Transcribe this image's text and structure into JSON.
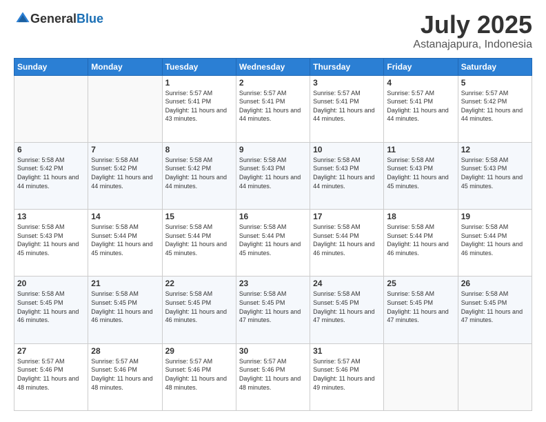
{
  "logo": {
    "text_general": "General",
    "text_blue": "Blue"
  },
  "header": {
    "month": "July 2025",
    "location": "Astanajapura, Indonesia"
  },
  "weekdays": [
    "Sunday",
    "Monday",
    "Tuesday",
    "Wednesday",
    "Thursday",
    "Friday",
    "Saturday"
  ],
  "weeks": [
    [
      {
        "day": "",
        "sunrise": "",
        "sunset": "",
        "daylight": ""
      },
      {
        "day": "",
        "sunrise": "",
        "sunset": "",
        "daylight": ""
      },
      {
        "day": "1",
        "sunrise": "Sunrise: 5:57 AM",
        "sunset": "Sunset: 5:41 PM",
        "daylight": "Daylight: 11 hours and 43 minutes."
      },
      {
        "day": "2",
        "sunrise": "Sunrise: 5:57 AM",
        "sunset": "Sunset: 5:41 PM",
        "daylight": "Daylight: 11 hours and 44 minutes."
      },
      {
        "day": "3",
        "sunrise": "Sunrise: 5:57 AM",
        "sunset": "Sunset: 5:41 PM",
        "daylight": "Daylight: 11 hours and 44 minutes."
      },
      {
        "day": "4",
        "sunrise": "Sunrise: 5:57 AM",
        "sunset": "Sunset: 5:41 PM",
        "daylight": "Daylight: 11 hours and 44 minutes."
      },
      {
        "day": "5",
        "sunrise": "Sunrise: 5:57 AM",
        "sunset": "Sunset: 5:42 PM",
        "daylight": "Daylight: 11 hours and 44 minutes."
      }
    ],
    [
      {
        "day": "6",
        "sunrise": "Sunrise: 5:58 AM",
        "sunset": "Sunset: 5:42 PM",
        "daylight": "Daylight: 11 hours and 44 minutes."
      },
      {
        "day": "7",
        "sunrise": "Sunrise: 5:58 AM",
        "sunset": "Sunset: 5:42 PM",
        "daylight": "Daylight: 11 hours and 44 minutes."
      },
      {
        "day": "8",
        "sunrise": "Sunrise: 5:58 AM",
        "sunset": "Sunset: 5:42 PM",
        "daylight": "Daylight: 11 hours and 44 minutes."
      },
      {
        "day": "9",
        "sunrise": "Sunrise: 5:58 AM",
        "sunset": "Sunset: 5:43 PM",
        "daylight": "Daylight: 11 hours and 44 minutes."
      },
      {
        "day": "10",
        "sunrise": "Sunrise: 5:58 AM",
        "sunset": "Sunset: 5:43 PM",
        "daylight": "Daylight: 11 hours and 44 minutes."
      },
      {
        "day": "11",
        "sunrise": "Sunrise: 5:58 AM",
        "sunset": "Sunset: 5:43 PM",
        "daylight": "Daylight: 11 hours and 45 minutes."
      },
      {
        "day": "12",
        "sunrise": "Sunrise: 5:58 AM",
        "sunset": "Sunset: 5:43 PM",
        "daylight": "Daylight: 11 hours and 45 minutes."
      }
    ],
    [
      {
        "day": "13",
        "sunrise": "Sunrise: 5:58 AM",
        "sunset": "Sunset: 5:43 PM",
        "daylight": "Daylight: 11 hours and 45 minutes."
      },
      {
        "day": "14",
        "sunrise": "Sunrise: 5:58 AM",
        "sunset": "Sunset: 5:44 PM",
        "daylight": "Daylight: 11 hours and 45 minutes."
      },
      {
        "day": "15",
        "sunrise": "Sunrise: 5:58 AM",
        "sunset": "Sunset: 5:44 PM",
        "daylight": "Daylight: 11 hours and 45 minutes."
      },
      {
        "day": "16",
        "sunrise": "Sunrise: 5:58 AM",
        "sunset": "Sunset: 5:44 PM",
        "daylight": "Daylight: 11 hours and 45 minutes."
      },
      {
        "day": "17",
        "sunrise": "Sunrise: 5:58 AM",
        "sunset": "Sunset: 5:44 PM",
        "daylight": "Daylight: 11 hours and 46 minutes."
      },
      {
        "day": "18",
        "sunrise": "Sunrise: 5:58 AM",
        "sunset": "Sunset: 5:44 PM",
        "daylight": "Daylight: 11 hours and 46 minutes."
      },
      {
        "day": "19",
        "sunrise": "Sunrise: 5:58 AM",
        "sunset": "Sunset: 5:44 PM",
        "daylight": "Daylight: 11 hours and 46 minutes."
      }
    ],
    [
      {
        "day": "20",
        "sunrise": "Sunrise: 5:58 AM",
        "sunset": "Sunset: 5:45 PM",
        "daylight": "Daylight: 11 hours and 46 minutes."
      },
      {
        "day": "21",
        "sunrise": "Sunrise: 5:58 AM",
        "sunset": "Sunset: 5:45 PM",
        "daylight": "Daylight: 11 hours and 46 minutes."
      },
      {
        "day": "22",
        "sunrise": "Sunrise: 5:58 AM",
        "sunset": "Sunset: 5:45 PM",
        "daylight": "Daylight: 11 hours and 46 minutes."
      },
      {
        "day": "23",
        "sunrise": "Sunrise: 5:58 AM",
        "sunset": "Sunset: 5:45 PM",
        "daylight": "Daylight: 11 hours and 47 minutes."
      },
      {
        "day": "24",
        "sunrise": "Sunrise: 5:58 AM",
        "sunset": "Sunset: 5:45 PM",
        "daylight": "Daylight: 11 hours and 47 minutes."
      },
      {
        "day": "25",
        "sunrise": "Sunrise: 5:58 AM",
        "sunset": "Sunset: 5:45 PM",
        "daylight": "Daylight: 11 hours and 47 minutes."
      },
      {
        "day": "26",
        "sunrise": "Sunrise: 5:58 AM",
        "sunset": "Sunset: 5:45 PM",
        "daylight": "Daylight: 11 hours and 47 minutes."
      }
    ],
    [
      {
        "day": "27",
        "sunrise": "Sunrise: 5:57 AM",
        "sunset": "Sunset: 5:46 PM",
        "daylight": "Daylight: 11 hours and 48 minutes."
      },
      {
        "day": "28",
        "sunrise": "Sunrise: 5:57 AM",
        "sunset": "Sunset: 5:46 PM",
        "daylight": "Daylight: 11 hours and 48 minutes."
      },
      {
        "day": "29",
        "sunrise": "Sunrise: 5:57 AM",
        "sunset": "Sunset: 5:46 PM",
        "daylight": "Daylight: 11 hours and 48 minutes."
      },
      {
        "day": "30",
        "sunrise": "Sunrise: 5:57 AM",
        "sunset": "Sunset: 5:46 PM",
        "daylight": "Daylight: 11 hours and 48 minutes."
      },
      {
        "day": "31",
        "sunrise": "Sunrise: 5:57 AM",
        "sunset": "Sunset: 5:46 PM",
        "daylight": "Daylight: 11 hours and 49 minutes."
      },
      {
        "day": "",
        "sunrise": "",
        "sunset": "",
        "daylight": ""
      },
      {
        "day": "",
        "sunrise": "",
        "sunset": "",
        "daylight": ""
      }
    ]
  ]
}
